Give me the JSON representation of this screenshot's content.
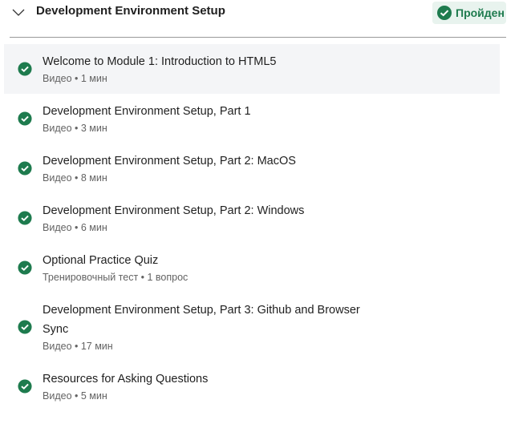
{
  "header": {
    "title": "Development Environment Setup",
    "status": "Пройден",
    "accent": "#1e7b4e"
  },
  "items": [
    {
      "title": "Welcome to Module 1: Introduction to HTML5",
      "meta": "Видео • 1 мин"
    },
    {
      "title": "Development Environment Setup, Part 1",
      "meta": "Видео • 3 мин"
    },
    {
      "title": "Development Environment Setup, Part 2: MacOS",
      "meta": "Видео • 8 мин"
    },
    {
      "title": "Development Environment Setup, Part 2: Windows",
      "meta": "Видео • 6 мин"
    },
    {
      "title": "Optional Practice Quiz",
      "meta": "Тренировочный тест • 1 вопрос"
    },
    {
      "title": "Development Environment Setup, Part 3: Github and Browser Sync",
      "meta": "Видео • 17 мин"
    },
    {
      "title": "Resources for Asking Questions",
      "meta": "Видео • 5 мин"
    }
  ]
}
